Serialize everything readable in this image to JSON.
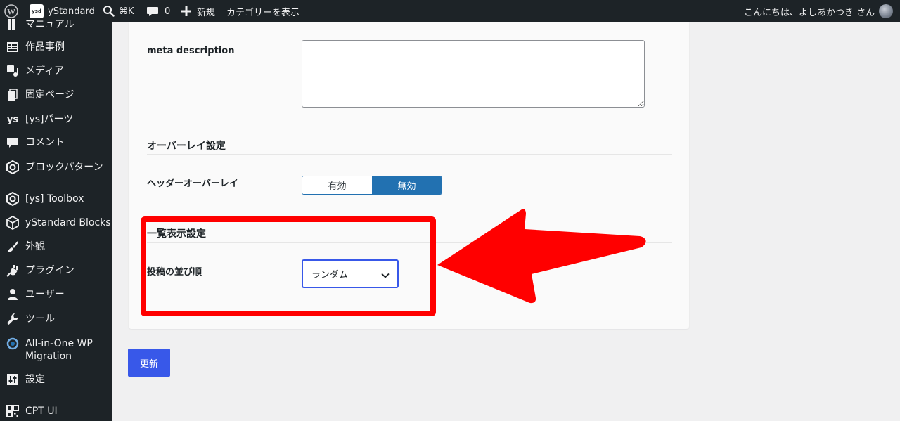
{
  "adminbar": {
    "site_badge": "ysd",
    "site_name": "yStandard",
    "shortcut": "⌘K",
    "comments_count": "0",
    "new_label": "新規",
    "category_link": "カテゴリーを表示",
    "greeting": "こんにちは、よしあかつき さん"
  },
  "sidebar": {
    "items": [
      {
        "label": "マニュアル",
        "icon": "manual-icon"
      },
      {
        "label": "作品事例",
        "icon": "list-icon"
      },
      {
        "label": "メディア",
        "icon": "media-icon"
      },
      {
        "label": "固定ページ",
        "icon": "page-icon"
      },
      {
        "label": "[ys]パーツ",
        "icon": "ys-icon",
        "icon_text": "ys"
      },
      {
        "label": "コメント",
        "icon": "comment-icon"
      },
      {
        "label": "ブロックパターン",
        "icon": "hexagon-icon"
      },
      {
        "label": "[ys] Toolbox",
        "icon": "hexagon-icon"
      },
      {
        "label": "yStandard Blocks",
        "icon": "cube-icon"
      },
      {
        "label": "外観",
        "icon": "brush-icon"
      },
      {
        "label": "プラグイン",
        "icon": "plugin-icon"
      },
      {
        "label": "ユーザー",
        "icon": "user-icon"
      },
      {
        "label": "ツール",
        "icon": "wrench-icon"
      },
      {
        "label": "All-in-One WP Migration",
        "label_line1": "All-in-One WP",
        "label_line2": "Migration",
        "icon": "migration-icon"
      },
      {
        "label": "設定",
        "icon": "settings-icon"
      },
      {
        "label": "CPT UI",
        "icon": "grid-icon"
      }
    ]
  },
  "form": {
    "meta_description_label": "meta description",
    "meta_description_value": "",
    "overlay_section_title": "オーバーレイ設定",
    "header_overlay_label": "ヘッダーオーバーレイ",
    "toggle_on": "有効",
    "toggle_off": "無効",
    "toggle_selected": "無効",
    "list_section_title": "一覧表示設定",
    "post_order_label": "投稿の並び順",
    "post_order_value": "ランダム"
  },
  "update_label": "更新",
  "colors": {
    "admin_dark": "#1d2327",
    "accent_blue": "#3858e9",
    "toggle_blue": "#2271b1",
    "highlight_red": "#ff0000"
  }
}
